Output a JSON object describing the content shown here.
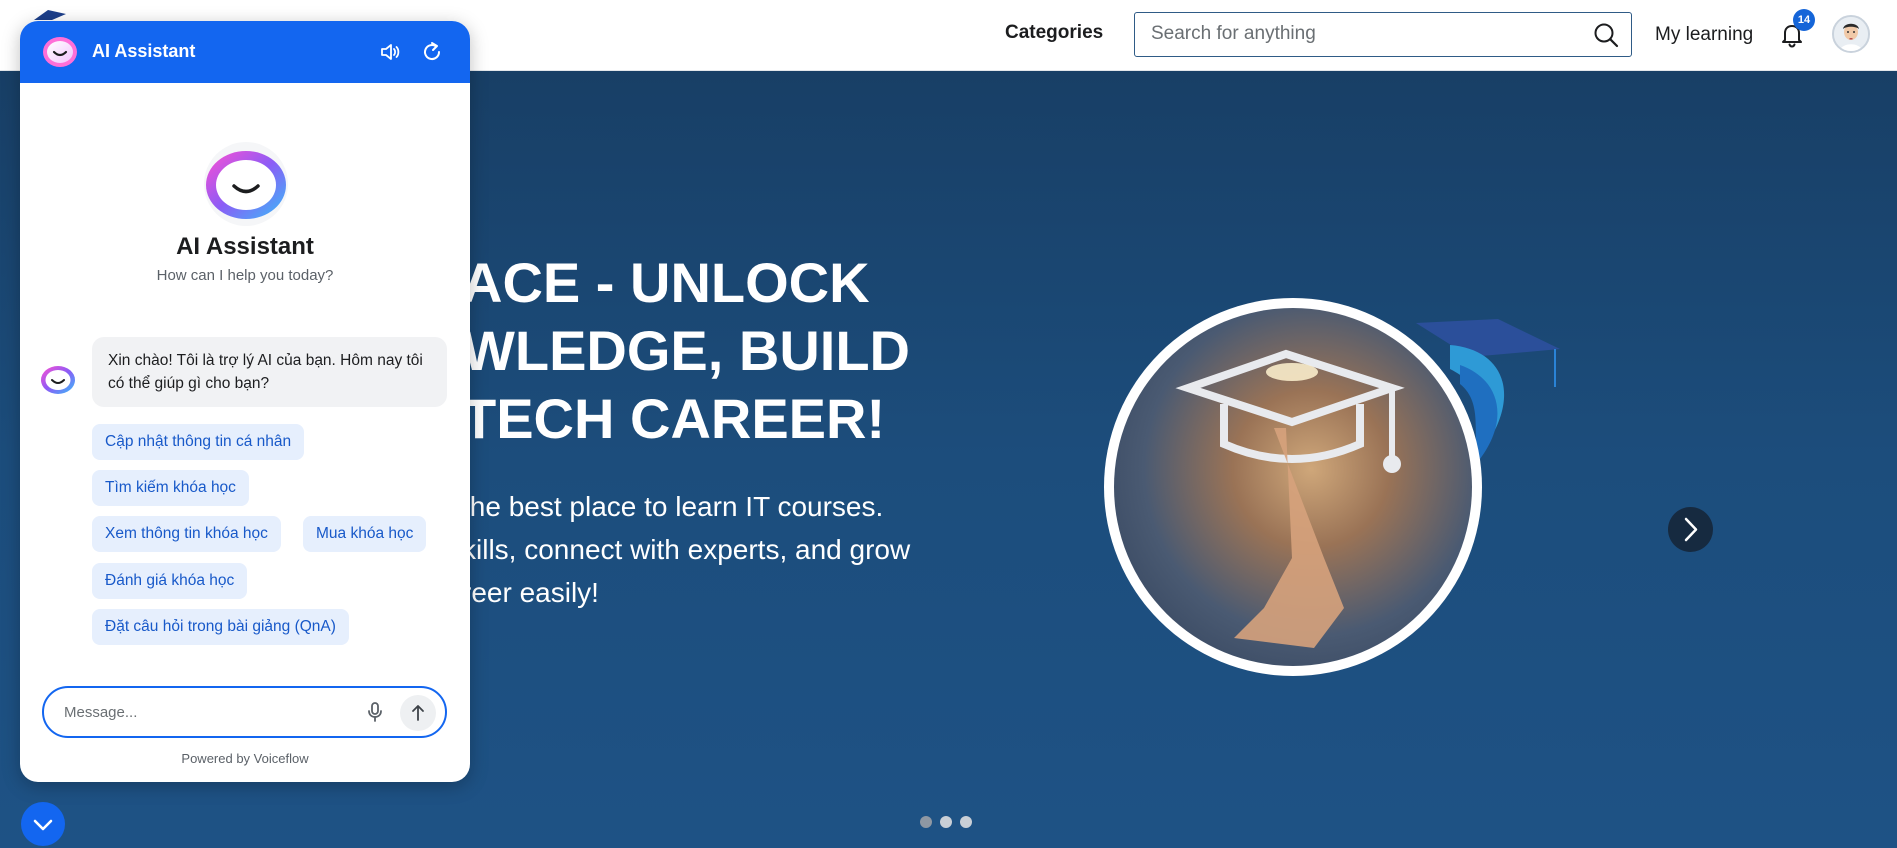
{
  "header": {
    "categories_label": "Categories",
    "search_placeholder": "Search for anything",
    "my_learning_label": "My learning",
    "notification_count": "14"
  },
  "hero": {
    "title_visible": "ACE - UNLOCK\nWLEDGE, BUILD\n TECH CAREER!",
    "subtitle_visible": "the best place to learn IT courses.\nkills, connect with experts, and grow\nreer easily!",
    "carousel_dots": 3,
    "active_dot": 0
  },
  "chat": {
    "header_title": "AI Assistant",
    "intro_title": "AI Assistant",
    "intro_subtitle": "How can I help you today?",
    "bot_message": "Xin chào! Tôi là trợ lý AI của bạn. Hôm nay tôi có thể giúp gì cho bạn?",
    "chips": [
      "Cập nhật thông tin cá nhân",
      "Tìm kiếm khóa học",
      "Xem thông tin khóa học",
      "Mua khóa học",
      "Đánh giá khóa học",
      "Đặt câu hỏi trong bài giảng (QnA)"
    ],
    "message_placeholder": "Message...",
    "powered_by": "Powered by Voiceflow"
  },
  "colors": {
    "accent": "#1366f0",
    "hero_bg": "#1b4d7a",
    "chip_bg": "#e6effd",
    "chip_text": "#1859c9",
    "badge": "#1565d8"
  },
  "icons": {
    "search": "search-icon",
    "bell": "bell-icon",
    "speaker": "speaker-icon",
    "refresh": "refresh-icon",
    "mic": "microphone-icon",
    "send": "arrow-up-icon",
    "next": "chevron-right-icon",
    "toggle": "chevron-down-icon"
  }
}
